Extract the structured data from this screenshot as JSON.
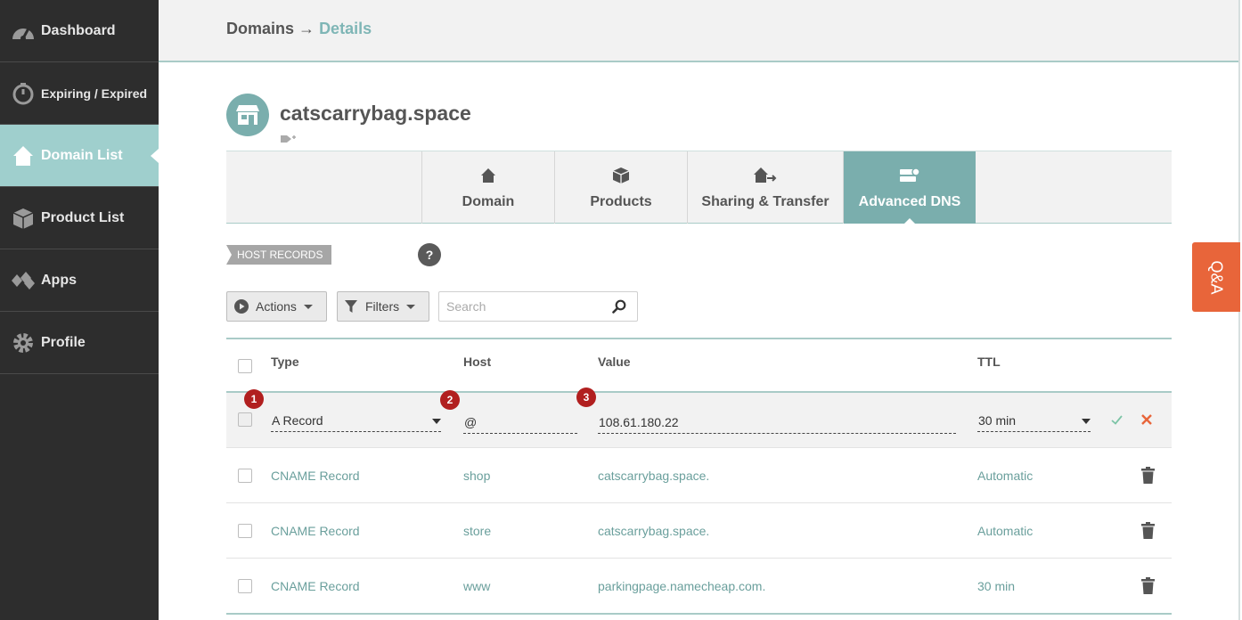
{
  "sidebar": {
    "items": [
      {
        "label": "Dashboard",
        "icon": "speedometer-icon"
      },
      {
        "label": "Expiring / Expired",
        "icon": "stopwatch-icon"
      },
      {
        "label": "Domain List",
        "icon": "house-icon"
      },
      {
        "label": "Product List",
        "icon": "box-icon"
      },
      {
        "label": "Apps",
        "icon": "diamonds-icon"
      },
      {
        "label": "Profile",
        "icon": "gear-icon"
      }
    ],
    "active_index": 2
  },
  "breadcrumb": {
    "parent": "Domains",
    "arrow": "→",
    "current": "Details"
  },
  "domain": {
    "name": "catscarrybag.space"
  },
  "tabs": [
    {
      "label": "Domain",
      "icon": "house-icon"
    },
    {
      "label": "Products",
      "icon": "box-icon"
    },
    {
      "label": "Sharing & Transfer",
      "icon": "share-house-icon"
    },
    {
      "label": "Advanced DNS",
      "icon": "server-icon"
    }
  ],
  "active_tab": "Advanced DNS",
  "section": {
    "label": "HOST RECORDS",
    "help": "?"
  },
  "toolbar": {
    "actions_label": "Actions",
    "filters_label": "Filters",
    "search_placeholder": "Search"
  },
  "table": {
    "headers": {
      "type": "Type",
      "host": "Host",
      "value": "Value",
      "ttl": "TTL"
    },
    "edit_row": {
      "type": "A Record",
      "host": "@",
      "value": "108.61.180.22",
      "ttl": "30 min",
      "badges": [
        "1",
        "2",
        "3"
      ]
    },
    "rows": [
      {
        "type": "CNAME Record",
        "host": "shop",
        "value": "catscarrybag.space.",
        "ttl": "Automatic"
      },
      {
        "type": "CNAME Record",
        "host": "store",
        "value": "catscarrybag.space.",
        "ttl": "Automatic"
      },
      {
        "type": "CNAME Record",
        "host": "www",
        "value": "parkingpage.namecheap.com.",
        "ttl": "30 min"
      }
    ]
  },
  "qa_button": {
    "label": "Q&A"
  },
  "colors": {
    "sidebar_bg": "#2d2d2d",
    "accent": "#7aaead",
    "active_sidebar": "#9fcfcd",
    "link": "#6a9f9c",
    "badge": "#b11f1f",
    "qa": "#e8653a",
    "confirm": "#7cc4a6",
    "cancel": "#e8653a"
  }
}
